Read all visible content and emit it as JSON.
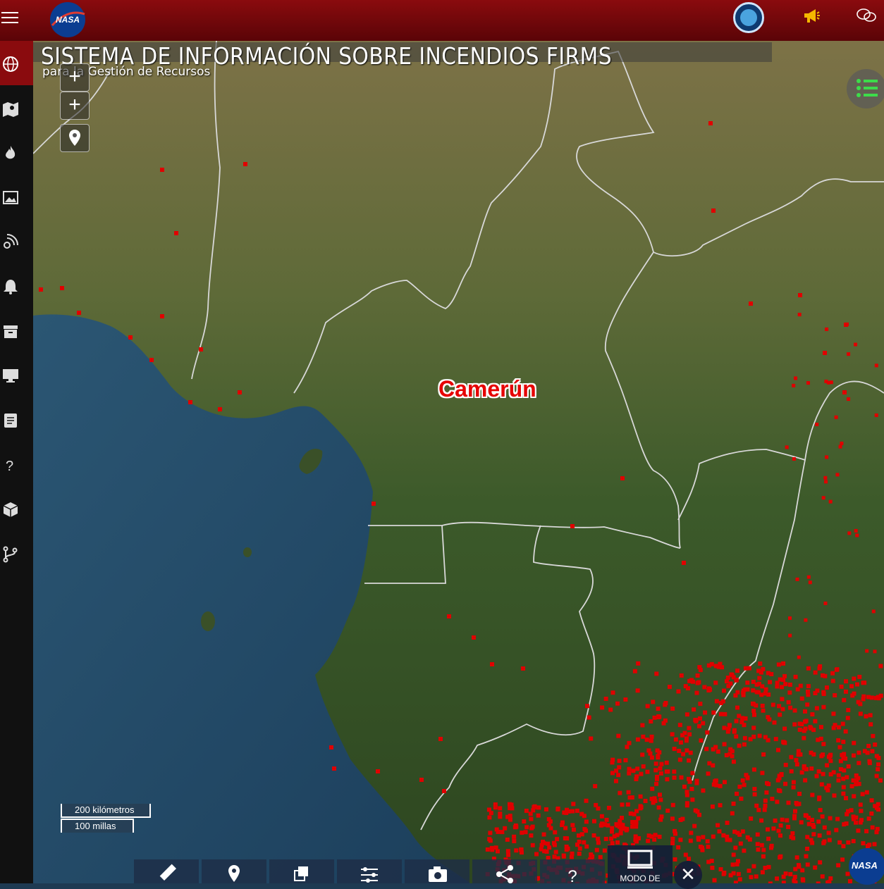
{
  "header": {
    "logo_text": "NASA",
    "icons": [
      "hamburger-menu-icon",
      "search-icon",
      "megaphone-icon",
      "chat-icon"
    ]
  },
  "app": {
    "title": "SISTEMA DE INFORMACIÓN SOBRE INCENDIOS FIRMS",
    "subtitle": "para la Gestión de Recursos"
  },
  "sidebar": {
    "items": [
      {
        "icon": "globe-icon",
        "active": true
      },
      {
        "icon": "map-icon"
      },
      {
        "icon": "fire-icon"
      },
      {
        "icon": "image-icon"
      },
      {
        "icon": "satellite-feed-icon"
      },
      {
        "icon": "bell-icon"
      },
      {
        "icon": "archive-icon"
      },
      {
        "icon": "monitor-icon"
      },
      {
        "icon": "document-icon"
      },
      {
        "icon": "help-icon"
      },
      {
        "icon": "cube-icon"
      },
      {
        "icon": "branch-icon"
      }
    ]
  },
  "map": {
    "country_label": "Camerún",
    "scale": {
      "km": "200 kilómetros",
      "mi": "100 millas"
    },
    "controls": [
      "zoom-in",
      "zoom-in",
      "location-pin"
    ]
  },
  "toolbar": {
    "buttons": [
      "ruler-icon",
      "pin-icon",
      "layers-copy-icon",
      "sliders-icon",
      "camera-icon",
      "share-icon",
      "help-icon"
    ],
    "help_label": "?",
    "modo_label": "MODO DE",
    "close_label": "✕"
  },
  "corner_logo_text": "NASA",
  "colors": {
    "header": "#8a0b0e",
    "fire_dot": "#e00000",
    "ocean": "#254c6a",
    "land_north": "#7a7448",
    "land_south": "#2f4a22"
  }
}
